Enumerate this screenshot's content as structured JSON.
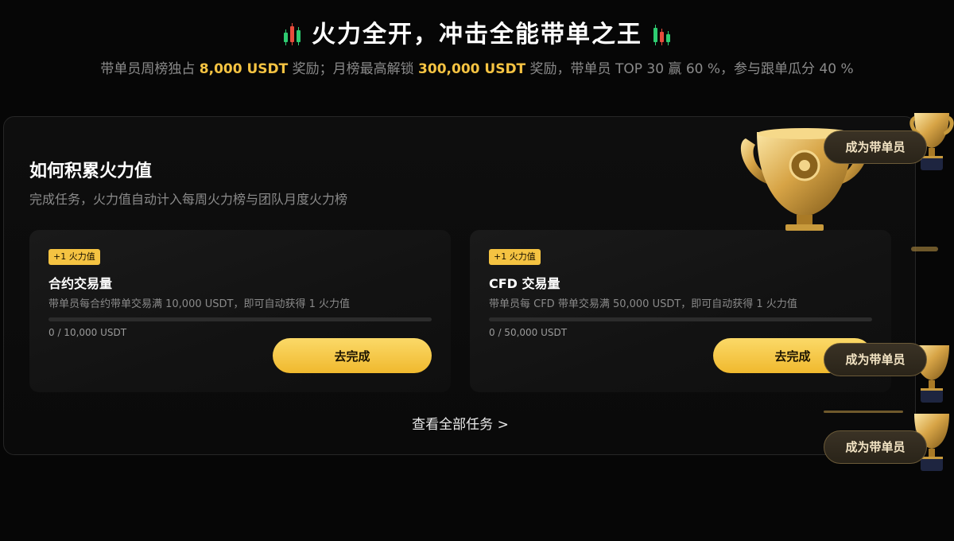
{
  "hero": {
    "title": "火力全开，冲击全能带单之王",
    "sub_prefix": "带单员周榜独占 ",
    "sub_weekly_amount": "8,000 USDT",
    "sub_mid": " 奖励；月榜最高解锁 ",
    "sub_monthly_amount": "300,000 USDT",
    "sub_suffix": " 奖励，带单员 TOP 30 赢 60 %，参与跟单瓜分 40 %"
  },
  "panel": {
    "title": "如何积累火力值",
    "subtitle": "完成任务，火力值自动计入每周火力榜与团队月度火力榜",
    "view_all": "查看全部任务 >"
  },
  "tasks": [
    {
      "badge": "+1 火力值",
      "title": "合约交易量",
      "description": "带单员每合约带单交易满 10,000 USDT，即可自动获得 1 火力值",
      "progress_text": "0 / 10,000 USDT",
      "progress": 0,
      "button": "去完成"
    },
    {
      "badge": "+1 火力值",
      "title": "CFD 交易量",
      "description": "带单员每 CFD 带单交易满 50,000 USDT，即可自动获得 1 火力值",
      "progress_text": "0 / 50,000 USDT",
      "progress": 0,
      "button": "去完成"
    }
  ],
  "cta": {
    "become_leader": "成为带单员"
  },
  "colors": {
    "accent": "#f5c342",
    "background": "#060606",
    "muted_text": "#8a8a8a"
  },
  "icons": [
    "candlestick-icon",
    "trophy-icon"
  ]
}
